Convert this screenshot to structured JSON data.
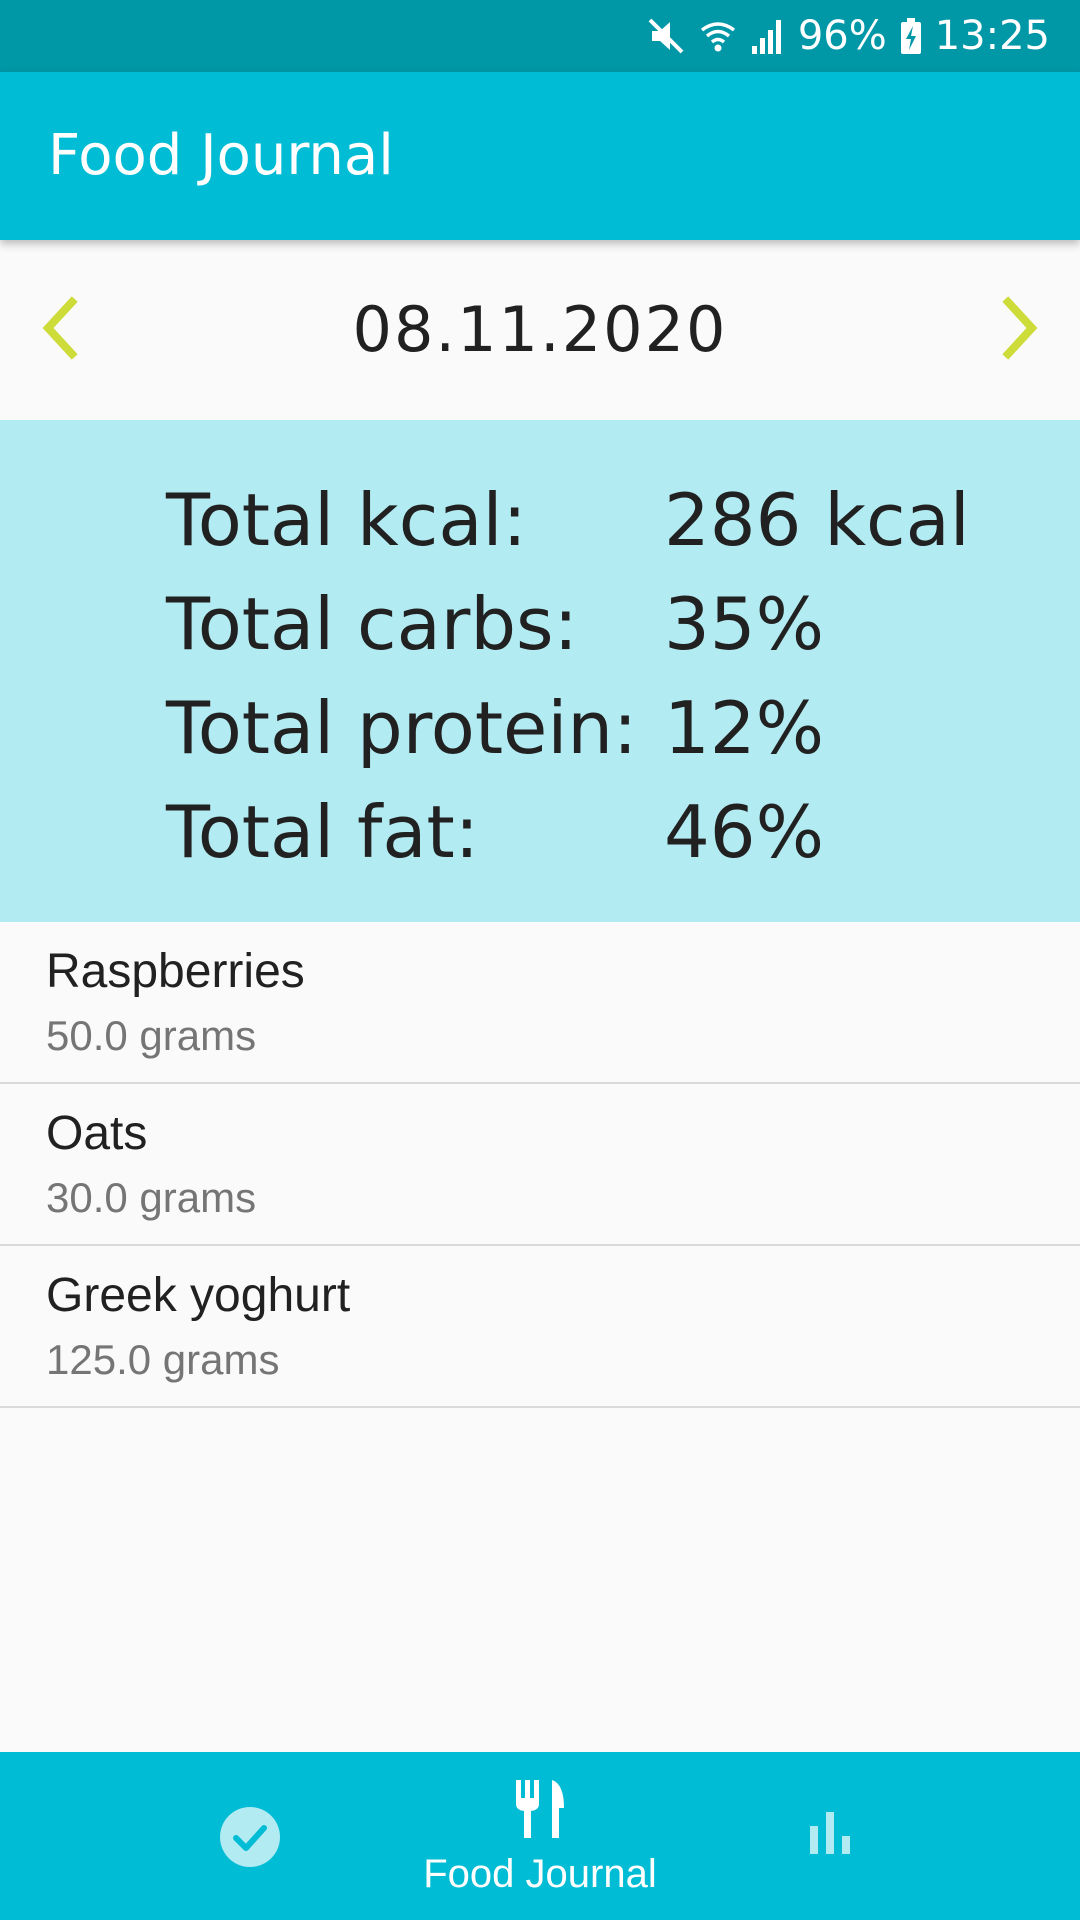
{
  "status_bar": {
    "battery": "96%",
    "time": "13:25",
    "icons": [
      "mute-icon",
      "wifi-icon",
      "signal-icon",
      "battery-charging-icon"
    ]
  },
  "app_bar": {
    "title": "Food Journal"
  },
  "date_nav": {
    "date": "08.11.2020",
    "prev_icon": "chevron-left-icon",
    "next_icon": "chevron-right-icon"
  },
  "summary": {
    "rows": [
      {
        "label": "Total kcal:",
        "value": "286 kcal"
      },
      {
        "label": "Total carbs:",
        "value": "35%"
      },
      {
        "label": "Total protein:",
        "value": "12%"
      },
      {
        "label": "Total fat:",
        "value": "46%"
      }
    ]
  },
  "foods": [
    {
      "name": "Raspberries",
      "amount": "50.0 grams"
    },
    {
      "name": "Oats",
      "amount": "30.0 grams"
    },
    {
      "name": "Greek yoghurt",
      "amount": "125.0 grams"
    }
  ],
  "bottom_nav": {
    "items": [
      {
        "icon": "check-circle-icon",
        "label": ""
      },
      {
        "icon": "fork-knife-icon",
        "label": "Food Journal",
        "active": true
      },
      {
        "icon": "bar-chart-icon",
        "label": ""
      }
    ]
  },
  "colors": {
    "status_bar": "#0097a7",
    "primary": "#00bcd4",
    "summary_bg": "#b2ebf2",
    "accent_arrows": "#cddc39",
    "divider": "#dadada"
  }
}
